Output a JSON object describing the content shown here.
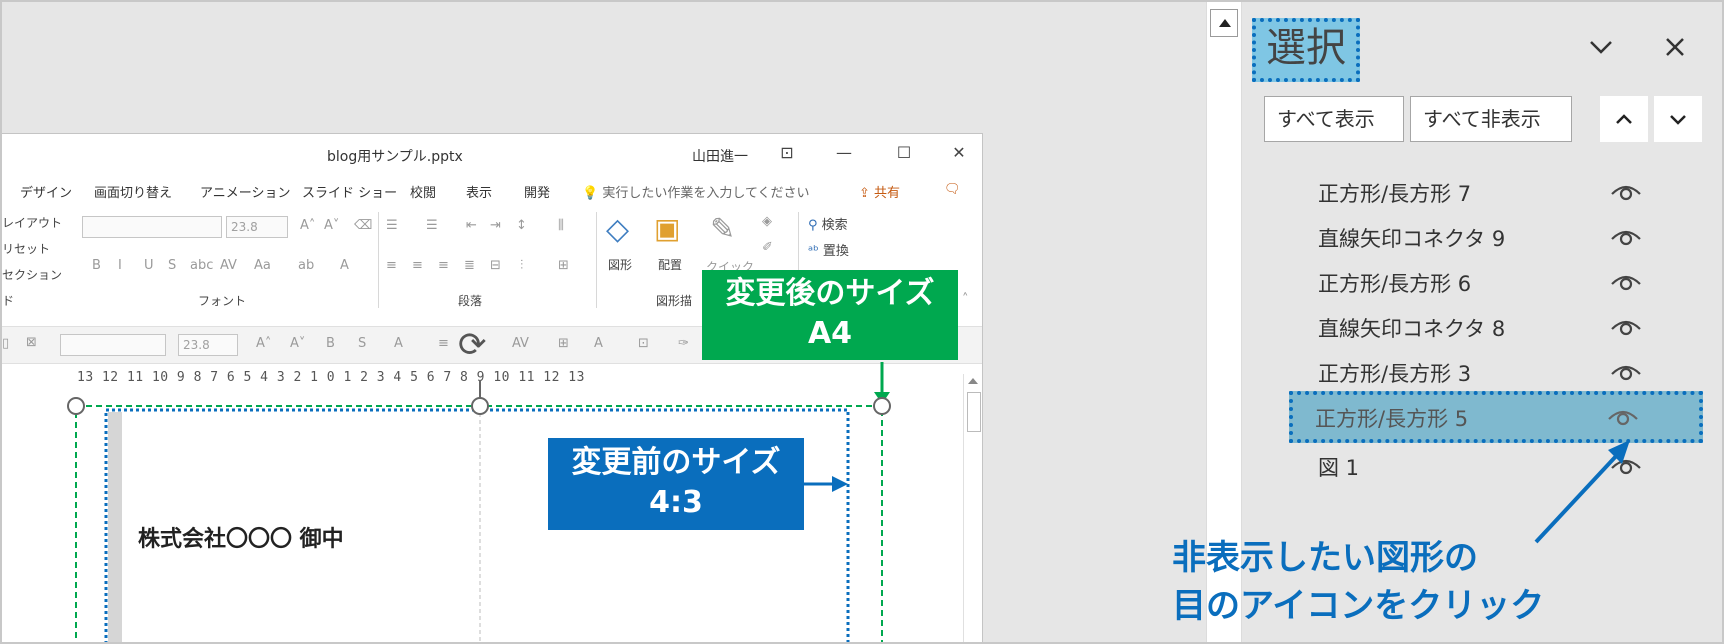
{
  "ppt": {
    "filename": "blog用サンプル.pptx",
    "user": "山田進一",
    "tabs": [
      "デザイン",
      "画面切り替え",
      "アニメーション",
      "スライド ショー",
      "校閲",
      "表示",
      "開発"
    ],
    "tell_me": "実行したい作業を入力してください",
    "share": "共有",
    "ribbon": {
      "left_items": [
        "レイアウト",
        "リセット",
        "セクション",
        "ド"
      ],
      "font_size": "23.8",
      "font_group": "フォント",
      "paragraph_group": "段落",
      "shape_label": "図形",
      "arrange_label": "配置",
      "quick_label": "クイック",
      "drawing_group": "図形描",
      "search_label": "検索",
      "replace_label": "置換",
      "fmt_font_size": "23.8"
    },
    "ruler": "13 12 11 10 9 8 7 6 5 4 3 2 1 0 1 2 3 4 5 6 7 8 9 10 11 12 13",
    "callout_after": [
      "変更後のサイズ",
      "A4"
    ],
    "callout_before": [
      "変更前のサイズ",
      "4:3"
    ],
    "company": "株式会社〇〇〇 御中"
  },
  "pane": {
    "title": "選択",
    "show_all": "すべて表示",
    "hide_all": "すべて非表示",
    "items": [
      {
        "label": "正方形/長方形 7"
      },
      {
        "label": "直線矢印コネクタ 9"
      },
      {
        "label": "正方形/長方形 6"
      },
      {
        "label": "直線矢印コネクタ 8"
      },
      {
        "label": "正方形/長方形 3"
      },
      {
        "label": "正方形/長方形 5"
      },
      {
        "label": "図 1"
      }
    ]
  },
  "instruction": [
    "非表示したい図形の",
    "目のアイコンをクリック"
  ],
  "colors": {
    "accent_blue": "#0a6ebd",
    "accent_green": "#00a84f",
    "highlight": "#7fb9cf"
  }
}
